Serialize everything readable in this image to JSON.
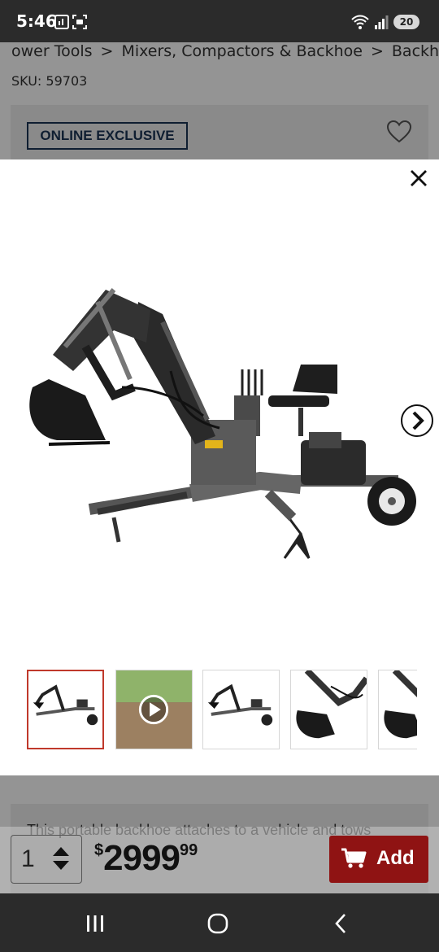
{
  "status_bar": {
    "time": "5:46",
    "battery": "20"
  },
  "breadcrumb": [
    {
      "label": "ower Tools"
    },
    {
      "label": "Mixers, Compactors & Backhoe"
    },
    {
      "label": "Backhoe"
    }
  ],
  "breadcrumb_separator": ">",
  "sku": "SKU: 59703",
  "badge": "ONLINE EXCLUSIVE",
  "description_preview": "This portable backhoe attaches to a vehicle and tows",
  "quantity": "1",
  "price": {
    "currency": "$",
    "dollars": "2999",
    "cents": "99"
  },
  "add_button": "Add",
  "gallery": {
    "thumbnails": [
      {
        "kind": "image",
        "icon": "backhoe-side-icon",
        "active": true
      },
      {
        "kind": "video",
        "icon": "play-icon",
        "active": false
      },
      {
        "kind": "image",
        "icon": "backhoe-side-icon",
        "active": false
      },
      {
        "kind": "image",
        "icon": "bucket-closeup-icon",
        "active": false
      },
      {
        "kind": "image",
        "icon": "bucket-closeup-icon",
        "active": false
      }
    ]
  },
  "colors": {
    "brand_red": "#8f1313",
    "badge_navy": "#1b3555",
    "active_thumb": "#c0392b"
  }
}
